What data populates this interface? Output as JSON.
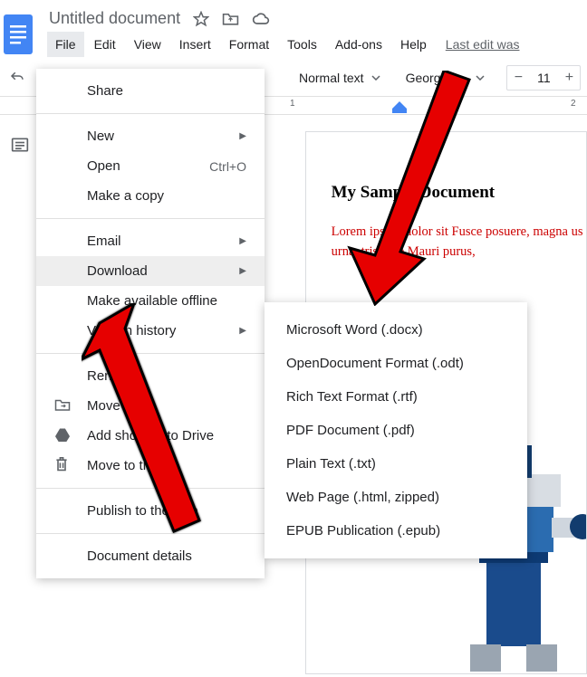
{
  "doc": {
    "title": "Untitled document"
  },
  "menubar": {
    "file": "File",
    "edit": "Edit",
    "view": "View",
    "insert": "Insert",
    "format": "Format",
    "tools": "Tools",
    "addons": "Add-ons",
    "help": "Help",
    "last_edit": "Last edit was"
  },
  "toolbar": {
    "style": "Normal text",
    "font": "Georgia",
    "font_size": "11",
    "minus": "−",
    "plus": "+"
  },
  "ruler": {
    "one": "1",
    "two": "2"
  },
  "file_menu": {
    "share": "Share",
    "new": "New",
    "open": "Open",
    "open_shortcut": "Ctrl+O",
    "make_copy": "Make a copy",
    "email": "Email",
    "download": "Download",
    "offline": "Make available offline",
    "version_history": "Version history",
    "rename": "Rename",
    "move": "Move",
    "add_shortcut": "Add shortcut to Drive",
    "trash": "Move to trash",
    "publish": "Publish to the web",
    "details": "Document details"
  },
  "download_submenu": {
    "docx": "Microsoft Word (.docx)",
    "odt": "OpenDocument Format (.odt)",
    "rtf": "Rich Text Format (.rtf)",
    "pdf": "PDF Document (.pdf)",
    "txt": "Plain Text (.txt)",
    "html": "Web Page (.html, zipped)",
    "epub": "EPUB Publication (.epub)"
  },
  "page_content": {
    "heading": "My Sample Document",
    "para": "Lorem ipsum dolor sit Fusce posuere, magna us urna. tristique Mauri purus,"
  }
}
